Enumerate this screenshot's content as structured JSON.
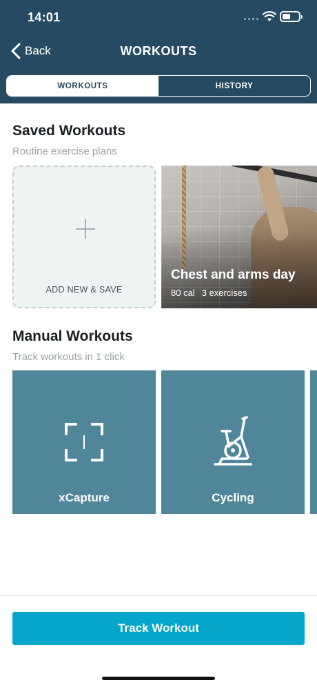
{
  "status_bar": {
    "time": "14:01"
  },
  "nav": {
    "back_label": "Back",
    "title": "WORKOUTS"
  },
  "tabs": [
    {
      "label": "WORKOUTS",
      "active": true
    },
    {
      "label": "HISTORY",
      "active": false
    }
  ],
  "saved": {
    "title": "Saved Workouts",
    "subtitle": "Routine exercise plans",
    "add_label": "ADD NEW & SAVE",
    "cards": [
      {
        "title": "Chest and arms day",
        "calories": "80 cal",
        "exercises": "3 exercises"
      }
    ]
  },
  "manual": {
    "title": "Manual Workouts",
    "subtitle": "Track workouts in 1 click",
    "items": [
      {
        "label": "xCapture",
        "icon": "scan-frame-icon"
      },
      {
        "label": "Cycling",
        "icon": "exercise-bike-icon"
      }
    ]
  },
  "footer": {
    "track_label": "Track Workout"
  },
  "colors": {
    "header": "#264a62",
    "card": "#4f8699",
    "accent": "#04a6cc"
  }
}
